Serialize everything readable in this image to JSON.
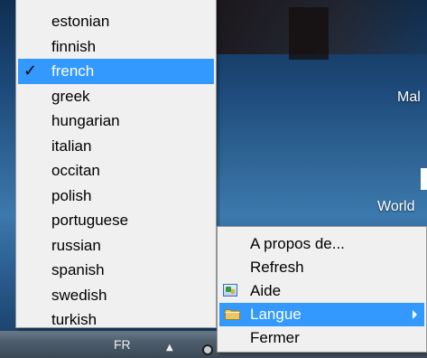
{
  "wallpaper": {
    "text_1": "Mal",
    "text_2": "World"
  },
  "language_menu": {
    "items": [
      {
        "label": "estonian",
        "selected": false
      },
      {
        "label": "finnish",
        "selected": false
      },
      {
        "label": "french",
        "selected": true
      },
      {
        "label": "greek",
        "selected": false
      },
      {
        "label": "hungarian",
        "selected": false
      },
      {
        "label": "italian",
        "selected": false
      },
      {
        "label": "occitan",
        "selected": false
      },
      {
        "label": "polish",
        "selected": false
      },
      {
        "label": "portuguese",
        "selected": false
      },
      {
        "label": "russian",
        "selected": false
      },
      {
        "label": "spanish",
        "selected": false
      },
      {
        "label": "swedish",
        "selected": false
      },
      {
        "label": "turkish",
        "selected": false
      }
    ],
    "check_glyph": "✓"
  },
  "tray_menu": {
    "items": [
      {
        "label": "A propos de...",
        "icon": ""
      },
      {
        "label": "Refresh",
        "icon": ""
      },
      {
        "label": "Aide",
        "icon": "help-icon"
      },
      {
        "label": "Langue",
        "icon": "folder-icon",
        "has_submenu": true,
        "selected": true
      },
      {
        "label": "Fermer",
        "icon": ""
      }
    ]
  },
  "taskbar": {
    "language_indicator": "FR",
    "show_hidden_icons_glyph": "▲"
  },
  "colors": {
    "menu_background": "#f0f0f0",
    "highlight": "#3399ff",
    "menu_border": "#979797"
  }
}
